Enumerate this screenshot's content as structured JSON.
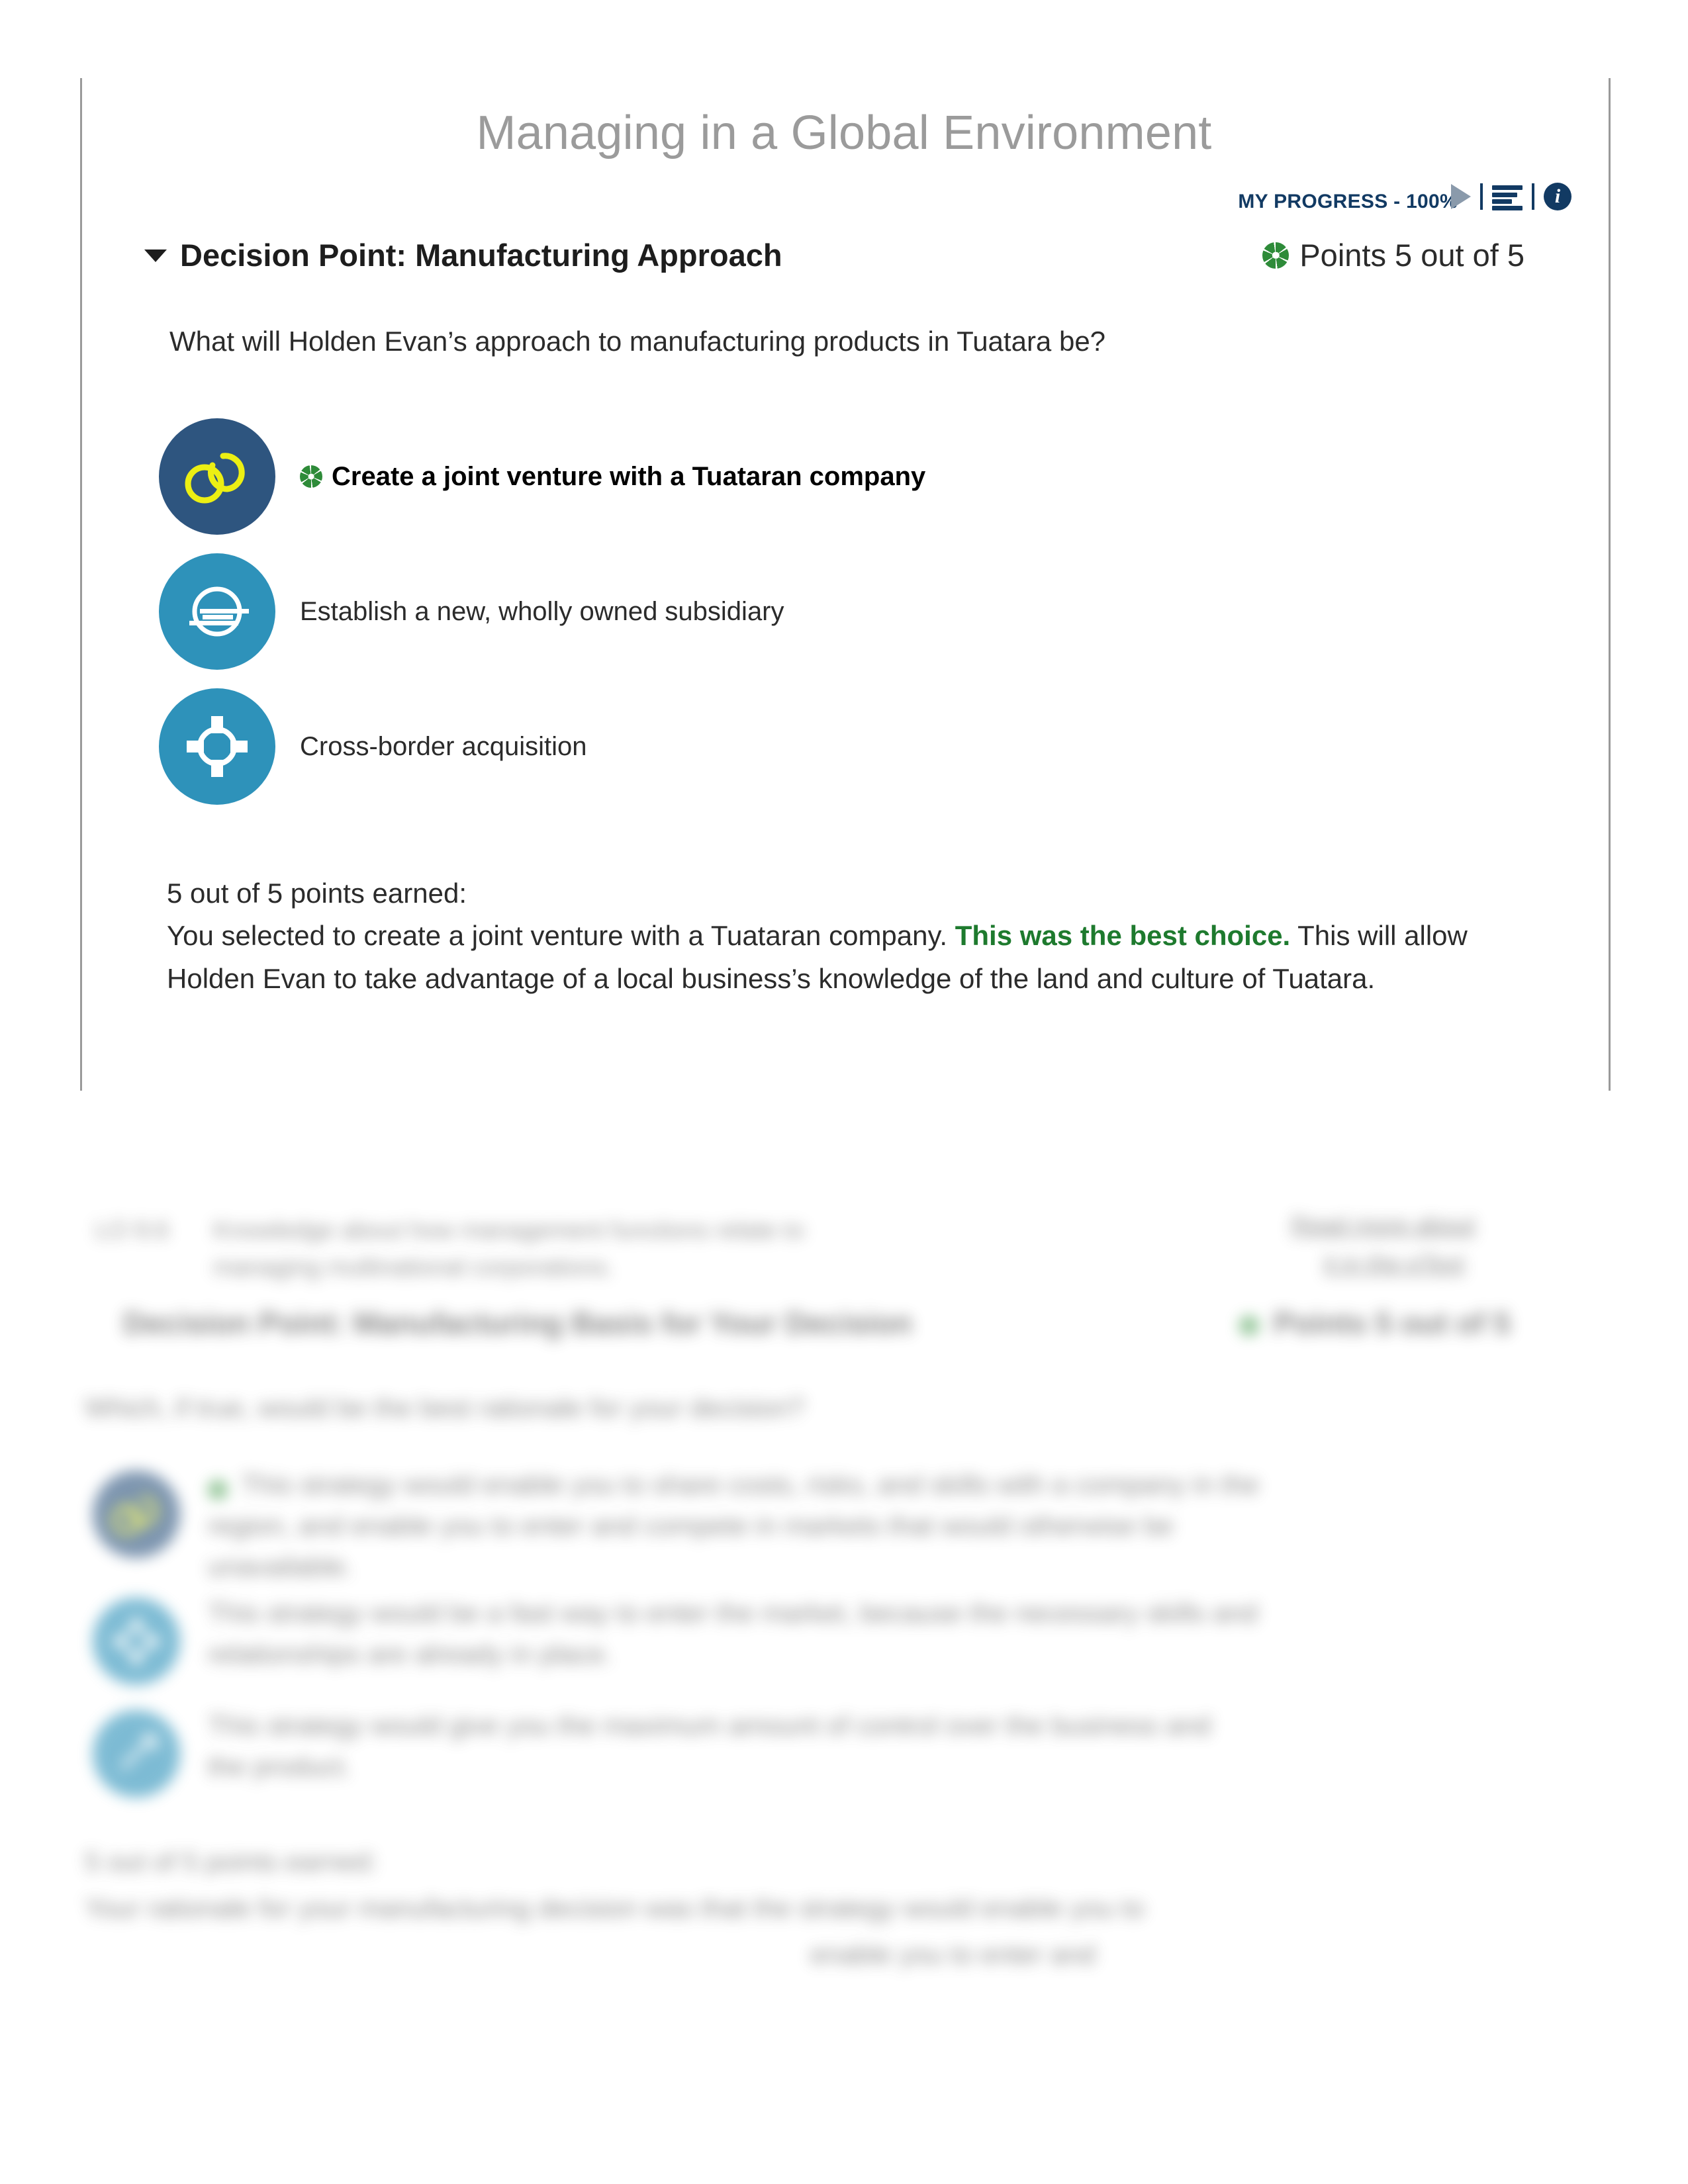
{
  "header": {
    "course_title": "Managing in a Global Environment",
    "progress_label": "MY PROGRESS - 100%",
    "toolbar": {
      "play_icon": "play-icon",
      "list_icon": "list-icon",
      "info_icon": "info-icon",
      "info_glyph": "i"
    }
  },
  "decision_point": {
    "caret": "caret-down-icon",
    "title": "Decision Point: Manufacturing Approach",
    "points_text": "Points 5 out of 5",
    "points_icon": "clover-icon",
    "question": "What will Holden Evan’s approach to manufacturing products in Tuatara be?",
    "options": [
      {
        "icon": "joint-venture-rings-icon",
        "label": "Create a joint venture with a Tuataran company",
        "selected": true,
        "badge_color": "#2e557f",
        "glyph_color": "#ecef13"
      },
      {
        "icon": "globe-lines-icon",
        "label": "Establish a new, wholly owned subsidiary",
        "selected": false,
        "badge_color": "#2e92ba",
        "glyph_color": "#ffffff"
      },
      {
        "icon": "crosshair-target-icon",
        "label": "Cross-border acquisition",
        "selected": false,
        "badge_color": "#2e92ba",
        "glyph_color": "#ffffff"
      }
    ],
    "feedback": {
      "earned": "5 out of 5 points earned:",
      "line1_part1": "You selected to create a joint venture with a Tuataran company. ",
      "line1_highlight": "This was the best choice.",
      "line2": "This will allow Holden Evan to take advantage of a local business’s knowledge of the land and culture of Tuatara."
    }
  },
  "blurred_section": {
    "note": "region below is rendered out of focus in the screenshot",
    "objective_code": "LO 9.6",
    "objective_text_line1": "Knowledge about how management functions relate to",
    "objective_text_line2": "managing multinational corporations.",
    "read_more_line1": "Read more about",
    "read_more_line2": "it in the eText",
    "dp2_title": "Decision Point: Manufacturing Basis for Your Decision",
    "dp2_points": "Points 5 out of 5",
    "dp2_question": "Which, if true, would be the best rationale for your decision?",
    "dp2_options": [
      {
        "badge_color": "#2e557f",
        "selected": true,
        "line1": "This strategy would enable you to share costs, risks, and skills with a company in the",
        "line2": "region, and enable you to enter and compete in markets that would otherwise be",
        "line3": "unavailable."
      },
      {
        "badge_color": "#2e92ba",
        "selected": false,
        "line1": "This strategy would be a fast way to enter the market, because the necessary skills and",
        "line2": "relationships are already in place.",
        "line3": ""
      },
      {
        "badge_color": "#2e92ba",
        "selected": false,
        "line1": "This strategy would give you the maximum amount of control over the business and",
        "line2": "the product.",
        "line3": ""
      }
    ],
    "dp2_feedback_earned": "5 out of 5 points earned:",
    "dp2_feedback_line1": "Your rationale for your manufacturing decision was that the strategy would enable you to",
    "dp2_feedback_line2": "enable you to enter and"
  },
  "colors": {
    "brand_navy": "#123a63",
    "badge_navy": "#2e557f",
    "badge_teal": "#2e92ba",
    "success_green": "#1e7a2e",
    "clover_green": "#2e8b39",
    "title_grey": "#9b9b9b",
    "rule_grey": "#9a9a9a"
  }
}
